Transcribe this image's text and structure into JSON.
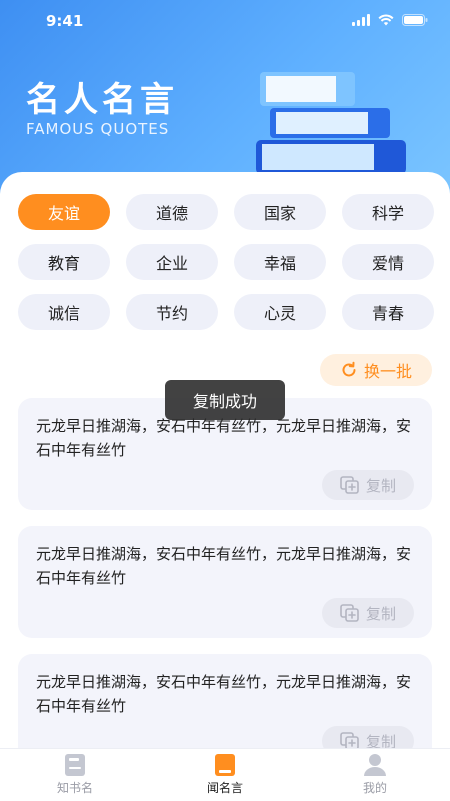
{
  "status": {
    "time": "9:41"
  },
  "header": {
    "title_cn": "名人名言",
    "title_en": "FAMOUS QUOTES"
  },
  "tags": [
    {
      "label": "友谊",
      "active": true
    },
    {
      "label": "道德",
      "active": false
    },
    {
      "label": "国家",
      "active": false
    },
    {
      "label": "科学",
      "active": false
    },
    {
      "label": "教育",
      "active": false
    },
    {
      "label": "企业",
      "active": false
    },
    {
      "label": "幸福",
      "active": false
    },
    {
      "label": "爱情",
      "active": false
    },
    {
      "label": "诚信",
      "active": false
    },
    {
      "label": "节约",
      "active": false
    },
    {
      "label": "心灵",
      "active": false
    },
    {
      "label": "青春",
      "active": false
    }
  ],
  "refresh_label": "换一批",
  "toast": "复制成功",
  "quotes": [
    {
      "text": "元龙早日推湖海，安石中年有丝竹，元龙早日推湖海，安石中年有丝竹",
      "copy": "复制"
    },
    {
      "text": "元龙早日推湖海，安石中年有丝竹，元龙早日推湖海，安石中年有丝竹",
      "copy": "复制"
    },
    {
      "text": "元龙早日推湖海，安石中年有丝竹，元龙早日推湖海，安石中年有丝竹",
      "copy": "复制"
    }
  ],
  "nav": [
    {
      "label": "知书名",
      "icon": "book-icon",
      "active": false
    },
    {
      "label": "闻名言",
      "icon": "quote-book-icon",
      "active": true
    },
    {
      "label": "我的",
      "icon": "user-icon",
      "active": false
    }
  ],
  "colors": {
    "accent": "#ff8e1f",
    "header_start": "#3e8ff2",
    "header_end": "#7cc6ff"
  }
}
